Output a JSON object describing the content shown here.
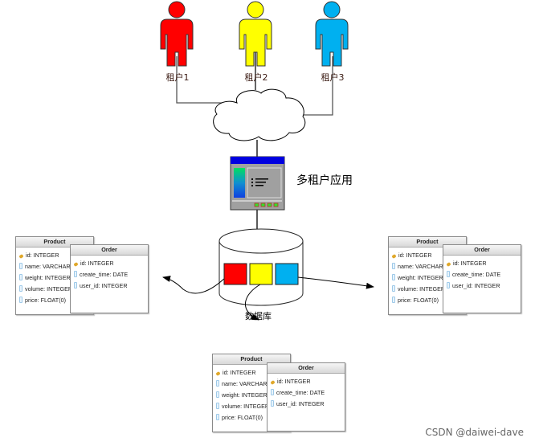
{
  "tenants": [
    {
      "label": "租户1",
      "color": "#ff0000"
    },
    {
      "label": "租户2",
      "color": "#ffff00"
    },
    {
      "label": "租户3",
      "color": "#00b0f0"
    }
  ],
  "app_label": "多租户应用",
  "db_label": "数据库",
  "watermark": "CSDN @daiwei-dave",
  "schemas": [
    {
      "product": {
        "title": "Product",
        "rows": [
          {
            "icon": "key",
            "text": "id: INTEGER"
          },
          {
            "icon": "column",
            "text": "name: VARCHAR"
          },
          {
            "icon": "column",
            "text": "weight: INTEGER"
          },
          {
            "icon": "column",
            "text": "volume: INTEGER"
          },
          {
            "icon": "column",
            "text": "price: FLOAT(0)"
          }
        ]
      },
      "order": {
        "title": "Order",
        "rows": [
          {
            "icon": "key",
            "text": "id: INTEGER"
          },
          {
            "icon": "column",
            "text": "create_time: DATE"
          },
          {
            "icon": "column",
            "text": "user_id: INTEGER"
          }
        ]
      }
    },
    {
      "product": {
        "title": "Product",
        "rows": [
          {
            "icon": "key",
            "text": "id: INTEGER"
          },
          {
            "icon": "column",
            "text": "name: VARCHAR"
          },
          {
            "icon": "column",
            "text": "weight: INTEGER"
          },
          {
            "icon": "column",
            "text": "volume: INTEGER"
          },
          {
            "icon": "column",
            "text": "price: FLOAT(0)"
          }
        ]
      },
      "order": {
        "title": "Order",
        "rows": [
          {
            "icon": "key",
            "text": "id: INTEGER"
          },
          {
            "icon": "column",
            "text": "create_time: DATE"
          },
          {
            "icon": "column",
            "text": "user_id: INTEGER"
          }
        ]
      }
    },
    {
      "product": {
        "title": "Product",
        "rows": [
          {
            "icon": "key",
            "text": "id: INTEGER"
          },
          {
            "icon": "column",
            "text": "name: VARCHAR"
          },
          {
            "icon": "column",
            "text": "weight: INTEGER"
          },
          {
            "icon": "column",
            "text": "volume: INTEGER"
          },
          {
            "icon": "column",
            "text": "price: FLOAT(0)"
          }
        ]
      },
      "order": {
        "title": "Order",
        "rows": [
          {
            "icon": "key",
            "text": "id: INTEGER"
          },
          {
            "icon": "column",
            "text": "create_time: DATE"
          },
          {
            "icon": "column",
            "text": "user_id: INTEGER"
          }
        ]
      }
    }
  ]
}
